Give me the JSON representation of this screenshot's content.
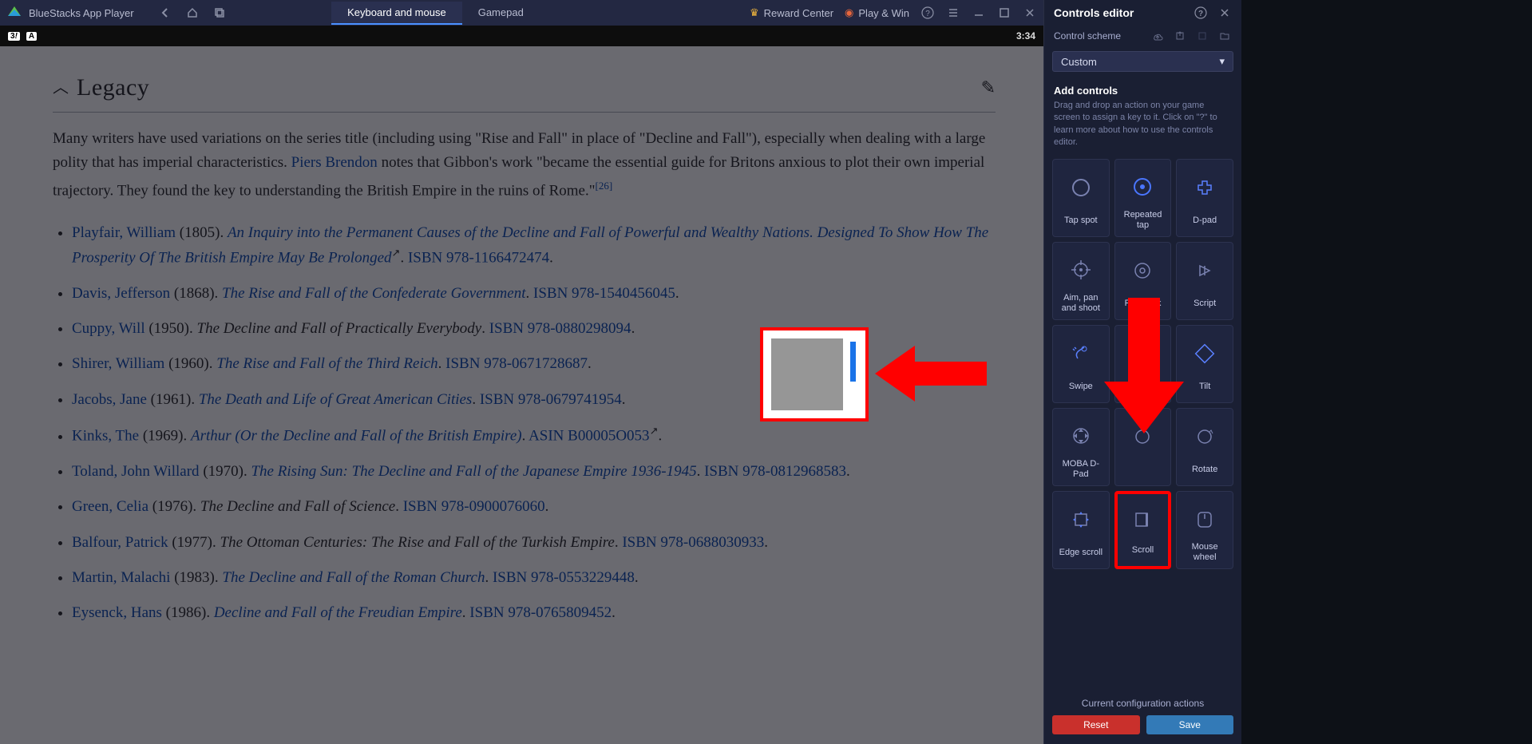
{
  "header": {
    "app_title": "BlueStacks App Player",
    "tabs": {
      "keyboard_mouse": "Keyboard and mouse",
      "gamepad": "Gamepad"
    },
    "reward_center": "Reward Center",
    "play_win": "Play & Win"
  },
  "secondary": {
    "clock": "3:34"
  },
  "wiki": {
    "heading": "Legacy",
    "para_text1": "Many writers have used variations on the series title (including using \"Rise and Fall\" in place of \"Decline and Fall\"), especially when dealing with a large polity that has imperial characteristics. ",
    "para_link": "Piers Brendon",
    "para_text2": " notes that Gibbon's work \"became the essential guide for Britons anxious to plot their own imperial trajectory. They found the key to understanding the British Empire in the ruins of Rome.\"",
    "cite": "[26]",
    "items": [
      {
        "author": "Playfair, William",
        "year": "(1805).",
        "title": "An Inquiry into the Permanent Causes of the Decline and Fall of Powerful and Wealthy Nations. Designed To Show How The Prosperity Of The British Empire May Be Prolonged",
        "ext": true,
        "isbn_label": "ISBN",
        "isbn": "978-1166472474",
        "dot": "."
      },
      {
        "author": "Davis, Jefferson",
        "year": "(1868).",
        "title": "The Rise and Fall of the Confederate Government",
        "isbn_label": "ISBN",
        "isbn": "978-1540456045",
        "dot": "."
      },
      {
        "author": "Cuppy, Will",
        "year": "(1950).",
        "title_plain": "The Decline and Fall of Practically Everybody",
        "isbn_label": "ISBN",
        "isbn": "978-0880298094",
        "dot": "."
      },
      {
        "author": "Shirer, William",
        "year": "(1960).",
        "title": "The Rise and Fall of the Third Reich",
        "isbn_label": "ISBN",
        "isbn": "978-0671728687",
        "dot": "."
      },
      {
        "author": "Jacobs, Jane",
        "year": "(1961).",
        "title": "The Death and Life of Great American Cities",
        "isbn_label": "ISBN",
        "isbn": "978-0679741954",
        "dot": "."
      },
      {
        "author": "Kinks, The",
        "year": "(1969).",
        "title": "Arthur (Or the Decline and Fall of the British Empire)",
        "asin_label": "ASIN",
        "asin": "B00005O053",
        "ext_after": true,
        "dot": "."
      },
      {
        "author": "Toland, John Willard",
        "year": "(1970).",
        "title": "The Rising Sun: The Decline and Fall of the Japanese Empire 1936-1945",
        "isbn_label": "ISBN",
        "isbn": "978-0812968583",
        "dot": "."
      },
      {
        "author": "Green, Celia",
        "year": "(1976).",
        "title_plain": "The Decline and Fall of Science",
        "isbn_label": "ISBN",
        "isbn": "978-0900076060",
        "dot": "."
      },
      {
        "author": "Balfour, Patrick",
        "year": "(1977).",
        "title_plain": "The Ottoman Centuries: The Rise and Fall of the Turkish Empire",
        "isbn_label": "ISBN",
        "isbn": "978-0688030933",
        "dot": "."
      },
      {
        "author": "Martin, Malachi",
        "year": "(1983).",
        "title": "The Decline and Fall of the Roman Church",
        "isbn_label": "ISBN",
        "isbn": "978-0553229448",
        "dot": "."
      },
      {
        "author": "Eysenck, Hans",
        "year": "(1986).",
        "title": "Decline and Fall of the Freudian Empire",
        "isbn_label": "ISBN",
        "isbn": "978-0765809452",
        "dot": "."
      }
    ]
  },
  "panel": {
    "title": "Controls editor",
    "scheme_label": "Control scheme",
    "scheme_value": "Custom",
    "add_title": "Add controls",
    "add_desc": "Drag and drop an action on your game screen to assign a key to it. Click on \"?\" to learn more about how to use the controls editor.",
    "tiles": [
      {
        "label": "Tap spot"
      },
      {
        "label": "Repeated tap"
      },
      {
        "label": "D-pad"
      },
      {
        "label": "Aim, pan and shoot"
      },
      {
        "label": "Free look"
      },
      {
        "label": "Script"
      },
      {
        "label": "Swipe"
      },
      {
        "label": ""
      },
      {
        "label": "Tilt"
      },
      {
        "label": "MOBA D-Pad"
      },
      {
        "label": ""
      },
      {
        "label": "Rotate"
      },
      {
        "label": "Edge scroll"
      },
      {
        "label": "Scroll",
        "highlight": true
      },
      {
        "label": "Mouse wheel"
      }
    ],
    "config_label": "Current configuration actions",
    "reset": "Reset",
    "save": "Save"
  }
}
